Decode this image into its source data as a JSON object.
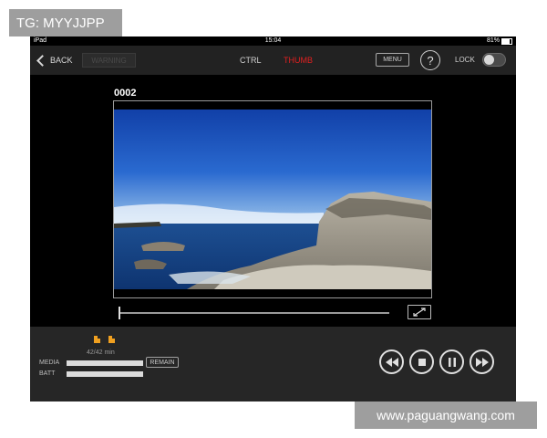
{
  "overlay": {
    "tag_text": "TG: MYYJJPP",
    "watermark_text": "www.paguangwang.com"
  },
  "status_bar": {
    "device": "iPad",
    "time": "15:04",
    "battery": "81%"
  },
  "top_bar": {
    "back_label": "BACK",
    "warning_label": "WARNING",
    "tabs": [
      {
        "label": "CTRL",
        "active": false
      },
      {
        "label": "THUMB",
        "active": true
      }
    ],
    "menu_label": "MENU",
    "help_label": "?",
    "lock_label": "LOCK",
    "lock_on": false
  },
  "clip": {
    "number": "0002"
  },
  "bottom_panel": {
    "remaining": "42/42 min",
    "media_label": "MEDIA",
    "batt_label": "BATT",
    "remain_button": "REMAIN"
  },
  "icons": {
    "back": "chevron-left-icon",
    "fullscreen": "expand-icon",
    "transport": [
      "rewind-icon",
      "stop-icon",
      "pause-icon",
      "fast-forward-icon"
    ]
  },
  "colors": {
    "active_tab": "#e02020",
    "media_icon": "#f0a020"
  }
}
